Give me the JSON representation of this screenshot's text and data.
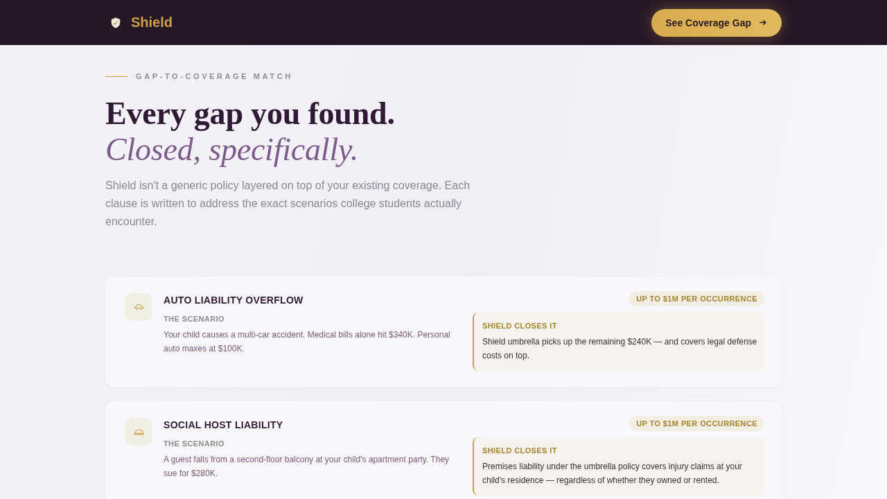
{
  "header": {
    "brand": "Shield",
    "cta": "See Coverage Gap"
  },
  "hero": {
    "eyebrow": "GAP-TO-COVERAGE MATCH",
    "title": "Every gap you found.",
    "title_accent": "Closed, specifically.",
    "intro": "Shield isn't a generic policy layered on top of your existing coverage. Each clause is written to address the exact scenarios college students actually encounter."
  },
  "gaps": [
    {
      "kind": "auto",
      "title": "AUTO LIABILITY OVERFLOW",
      "scenario_label": "THE SCENARIO",
      "scenario": "Your child causes a multi-car accident. Medical bills alone hit $340K. Personal auto maxes at $100K.",
      "limit": "UP TO $1M PER OCCURRENCE",
      "closes_label": "SHIELD CLOSES IT",
      "closes": "Shield umbrella picks up the remaining $240K — and covers legal defense costs on top."
    },
    {
      "kind": "premises",
      "title": "SOCIAL HOST LIABILITY",
      "scenario_label": "THE SCENARIO",
      "scenario": "A guest falls from a second-floor balcony at your child's apartment party. They sue for $280K.",
      "limit": "UP TO $1M PER OCCURRENCE",
      "closes_label": "SHIELD CLOSES IT",
      "closes": "Premises liability under the umbrella policy covers injury claims at your child's residence — regardless of whether they owned or rented."
    }
  ]
}
